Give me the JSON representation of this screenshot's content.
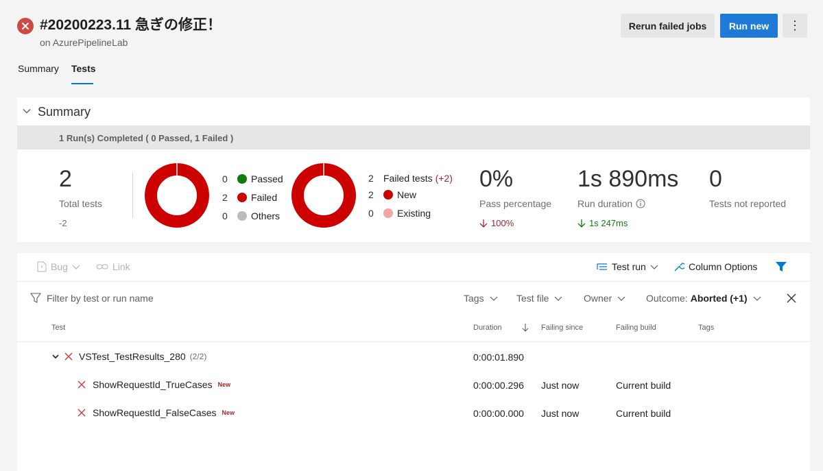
{
  "header": {
    "title": "#20200223.11 急ぎの修正！",
    "subtitle": "on AzurePipelineLab",
    "rerun_label": "Rerun failed jobs",
    "run_new_label": "Run new",
    "more_label": "⋮"
  },
  "tabs": [
    {
      "label": "Summary",
      "selected": false
    },
    {
      "label": "Tests",
      "selected": true
    }
  ],
  "summary": {
    "title": "Summary",
    "completed_text": "1 Run(s) Completed ( 0 Passed, 1 Failed )",
    "total_tests": {
      "value": "2",
      "label": "Total tests",
      "delta": "-2"
    },
    "outcome_legend": [
      {
        "count": "0",
        "label": "Passed",
        "color": "#107c10"
      },
      {
        "count": "2",
        "label": "Failed",
        "color": "#cd0000"
      },
      {
        "count": "0",
        "label": "Others",
        "color": "#bcbcbc"
      }
    ],
    "failed_legend": {
      "count": "2",
      "label": "Failed tests",
      "delta": "(+2)",
      "items": [
        {
          "count": "2",
          "label": "New",
          "color": "#cd0000"
        },
        {
          "count": "0",
          "label": "Existing",
          "color": "#f0a6a6"
        }
      ]
    },
    "pass_percentage": {
      "value": "0%",
      "label": "Pass percentage",
      "delta": "100%"
    },
    "run_duration": {
      "value": "1s 890ms",
      "label": "Run duration",
      "delta": "1s 247ms"
    },
    "not_reported": {
      "value": "0",
      "label": "Tests not reported"
    },
    "donut_fraction": 1.0,
    "colors": {
      "failed": "#cd0000",
      "passed": "#107c10",
      "others": "#bcbcbc"
    }
  },
  "toolbar": {
    "bug_label": "Bug",
    "link_label": "Link",
    "test_run_label": "Test run",
    "column_options_label": "Column Options"
  },
  "filters": {
    "search_placeholder": "Filter by test or run name",
    "tags_label": "Tags",
    "test_file_label": "Test file",
    "owner_label": "Owner",
    "outcome_label": "Outcome:",
    "outcome_value": "Aborted (+1)"
  },
  "table": {
    "columns": [
      "Test",
      "Duration",
      "Failing since",
      "Failing build",
      "Tags"
    ],
    "group": {
      "name": "VSTest_TestResults_280",
      "count": "(2/2)",
      "duration": "0:00:01.890"
    },
    "rows": [
      {
        "name": "ShowRequestId_TrueCases",
        "badge": "New",
        "duration": "0:00:00.296",
        "failing_since": "Just now",
        "failing_build": "Current build"
      },
      {
        "name": "ShowRequestId_FalseCases",
        "badge": "New",
        "duration": "0:00:00.000",
        "failing_since": "Just now",
        "failing_build": "Current build"
      }
    ]
  }
}
